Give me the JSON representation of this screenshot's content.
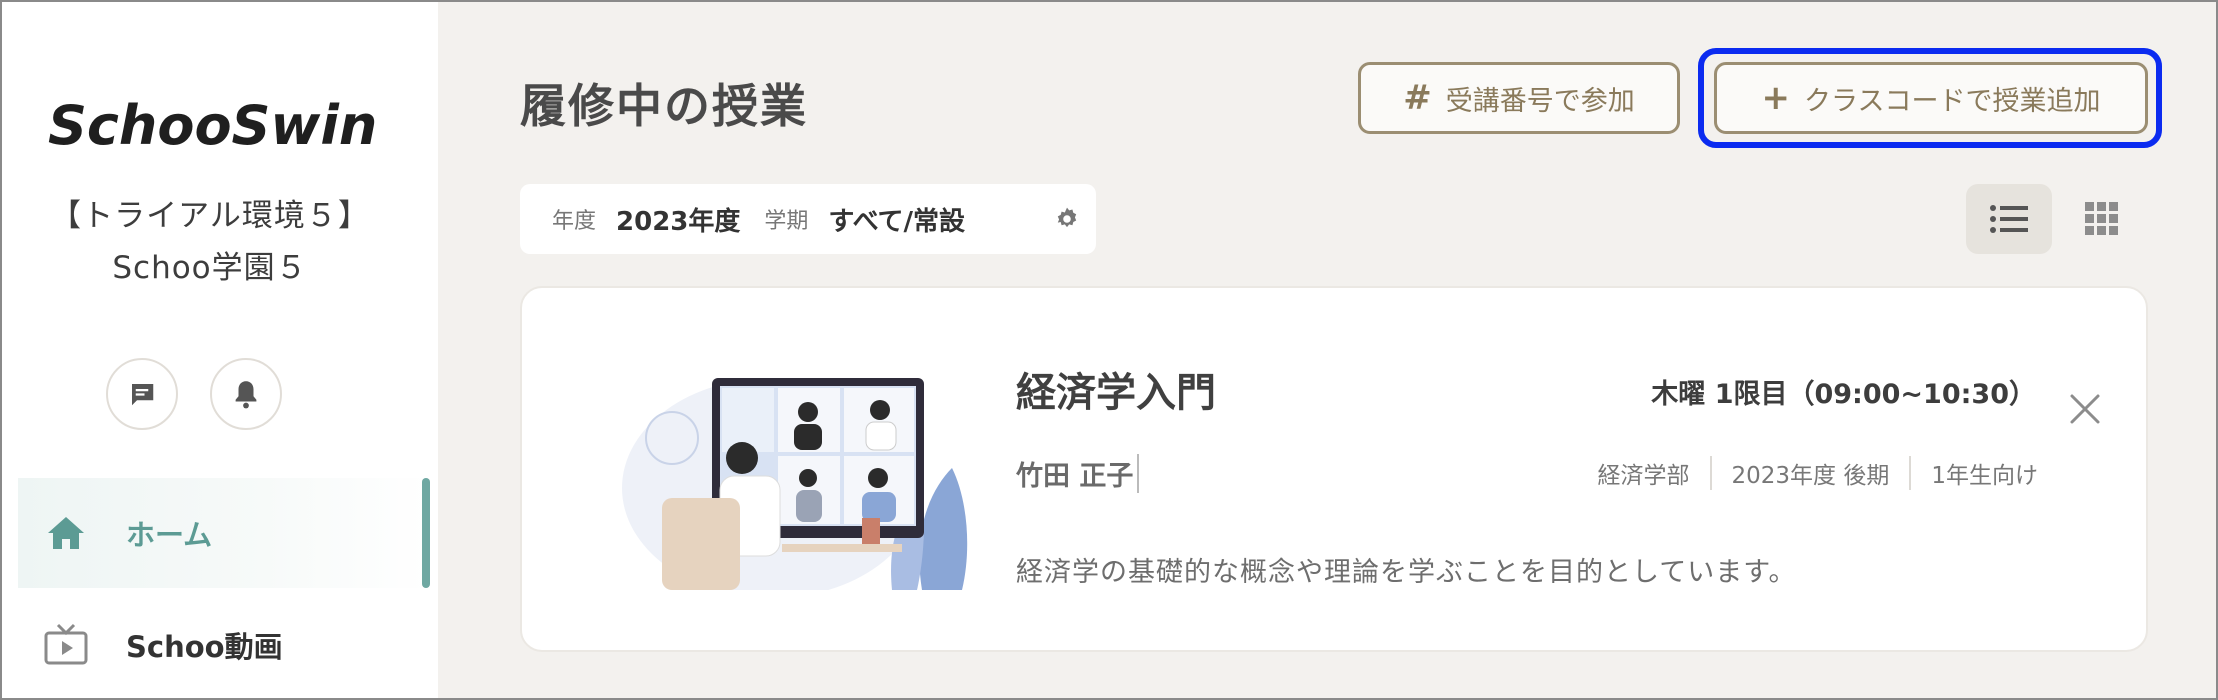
{
  "sidebar": {
    "logo_text": "SchooSwing",
    "org_name": "【トライアル環境５】Schoo学園５",
    "icons": {
      "chat": "chat-icon",
      "bell": "bell-icon"
    },
    "nav": [
      {
        "label": "ホーム",
        "icon": "home-icon",
        "active": true
      },
      {
        "label": "Schoo動画",
        "icon": "video-icon",
        "active": false
      }
    ]
  },
  "header": {
    "title": "履修中の授業",
    "join_button": {
      "glyph": "#",
      "label": "受講番号で参加"
    },
    "add_button": {
      "glyph": "+",
      "label": "クラスコードで授業追加"
    }
  },
  "filter": {
    "year_label": "年度",
    "year_value": "2023年度",
    "term_label": "学期",
    "term_value": "すべて/常設"
  },
  "view_toggle": {
    "list": "list-view-icon",
    "grid": "grid-view-icon",
    "selected": "list"
  },
  "course": {
    "title": "経済学入門",
    "schedule": "木曜 1限目（09:00~10:30）",
    "teacher": "竹田 正子",
    "meta": [
      "経済学部",
      "2023年度 後期",
      "1年生向け"
    ],
    "description": "経済学の基礎的な概念や理論を学ぶことを目的としています。"
  },
  "colors": {
    "accent_teal": "#5c9b94",
    "button_border": "#9b8e72",
    "focus_ring": "#0b2bf0",
    "background": "#f3f1ee"
  }
}
